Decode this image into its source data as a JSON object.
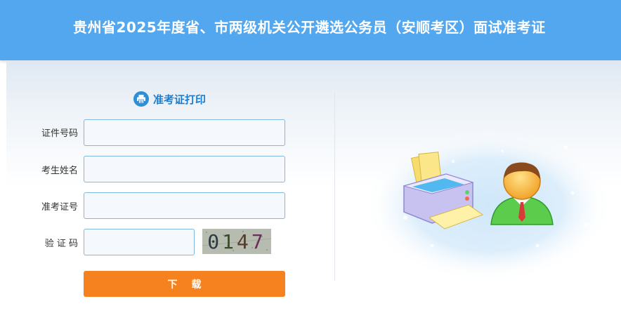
{
  "header": {
    "title": "贵州省2025年度省、市两级机关公开遴选公务员（安顺考区）面试准考证"
  },
  "panel": {
    "title": "准考证打印",
    "title_icon": "printer-icon"
  },
  "form": {
    "id_label": "证件号码",
    "id_value": "",
    "name_label": "考生姓名",
    "name_value": "",
    "ticket_label": "准考证号",
    "ticket_value": "",
    "captcha_label": "验 证 码",
    "captcha_value": "",
    "captcha_chars": [
      "0",
      "1",
      "4",
      "7"
    ]
  },
  "actions": {
    "download_label": "下载"
  },
  "colors": {
    "header_bg": "#53a7ee",
    "accent_blue": "#1c7ed0",
    "button_orange": "#f5821f",
    "input_border": "#7fb8e0"
  },
  "illustration": {
    "icons": [
      "printer-illustration",
      "user-avatar-illustration"
    ]
  }
}
